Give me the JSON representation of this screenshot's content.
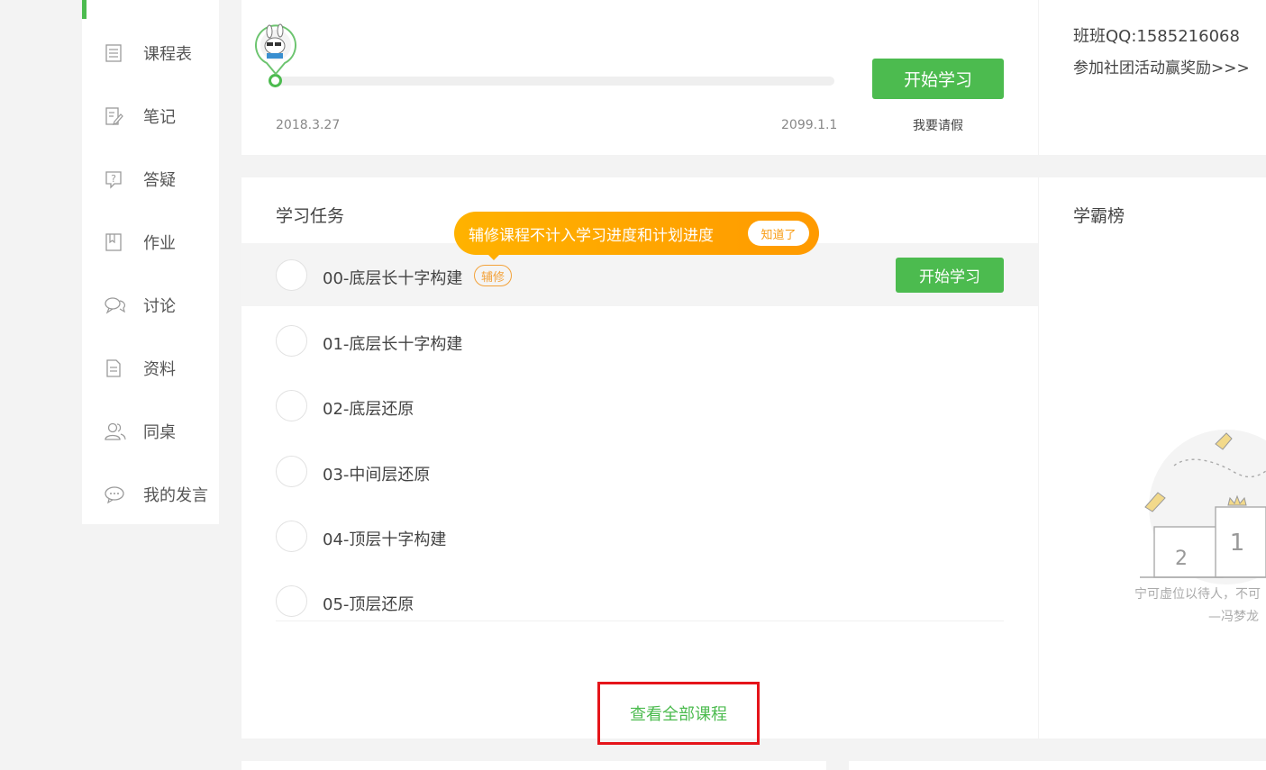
{
  "sidebar": {
    "items": [
      {
        "label": "课程表",
        "icon": "list-icon"
      },
      {
        "label": "笔记",
        "icon": "note-icon"
      },
      {
        "label": "答疑",
        "icon": "question-icon"
      },
      {
        "label": "作业",
        "icon": "bookmark-icon"
      },
      {
        "label": "讨论",
        "icon": "chat-icon"
      },
      {
        "label": "资料",
        "icon": "document-icon"
      },
      {
        "label": "同桌",
        "icon": "users-icon"
      },
      {
        "label": "我的发言",
        "icon": "comment-icon"
      }
    ]
  },
  "plan": {
    "start_date": "2018.3.27",
    "end_date": "2099.1.1",
    "start_label": "开始学习",
    "leave_label": "我要请假",
    "progress": 0
  },
  "class_info": {
    "qq": "班班QQ:1585216068",
    "club_link": "参加社团活动赢奖励>>>"
  },
  "tasks": {
    "title": "学习任务",
    "tooltip_text": "辅修课程不计入学习进度和计划进度",
    "tooltip_button": "知道了",
    "items": [
      {
        "name": "00-底层长十字构建",
        "tag": "辅修",
        "button": "开始学习"
      },
      {
        "name": "01-底层长十字构建"
      },
      {
        "name": "02-底层还原"
      },
      {
        "name": "03-中间层还原"
      },
      {
        "name": "04-顶层十字构建"
      },
      {
        "name": "05-顶层还原"
      }
    ],
    "view_all": "查看全部课程"
  },
  "ranking": {
    "title": "学霸榜",
    "podium_first": "1",
    "podium_second": "2",
    "quote": "宁可虚位以待人，不可",
    "quote_author": "—冯梦龙"
  },
  "colors": {
    "accent": "#4cbb4f",
    "tooltip": "#ff9a00",
    "highlight_box": "#e5141a"
  }
}
